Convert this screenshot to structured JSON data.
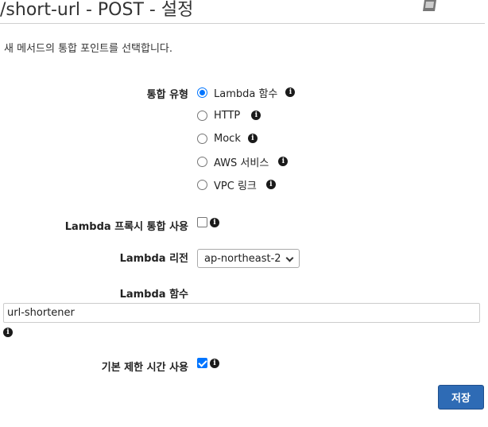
{
  "header": {
    "title": "/short-url - POST - 설정",
    "book_icon": "book-icon"
  },
  "description": "새 메서드의 통합 포인트를 선택합니다.",
  "integration_type": {
    "label": "통합 유형",
    "selected": "Lambda 함수",
    "options": [
      {
        "label": "Lambda 함수",
        "checked": true
      },
      {
        "label": "HTTP",
        "checked": false
      },
      {
        "label": "Mock",
        "checked": false
      },
      {
        "label": "AWS 서비스",
        "checked": false
      },
      {
        "label": "VPC 링크",
        "checked": false
      }
    ]
  },
  "proxy": {
    "label": "Lambda 프록시 통합 사용",
    "checked": false
  },
  "region": {
    "label": "Lambda 리전",
    "value": "ap-northeast-2"
  },
  "lambda_function": {
    "label": "Lambda 함수",
    "value": "url-shortener"
  },
  "default_timeout": {
    "label": "기본 제한 시간 사용",
    "checked": true
  },
  "save_button": {
    "label": "저장",
    "color": "#2e6bb5"
  },
  "info_icon": "info-icon",
  "accent_color": "#0075ff"
}
